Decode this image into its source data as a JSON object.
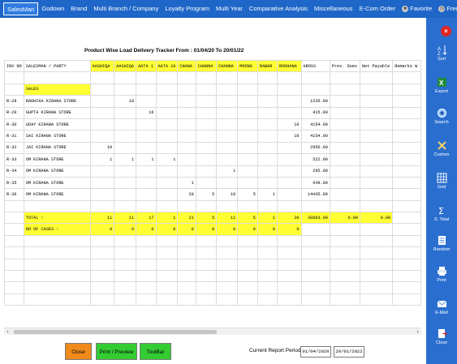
{
  "menu": {
    "items": [
      "SalesMan",
      "Godown",
      "Brand",
      "Multi Branch / Company",
      "Loyalty Program",
      "Multi Year",
      "Comparative Analysis",
      "Miscellaneous",
      "E-Com Order",
      "Favorite",
      "Frequent"
    ]
  },
  "report": {
    "title": "Product Wise Load  Delivery Tracker From : 01/04/20 To 20/01/22"
  },
  "grid": {
    "headers": [
      "INV NO",
      "SALESMAN / PARTY",
      "AASHIQA",
      "AASHIQA",
      "AATA 1",
      "AATA 10",
      "CHANA",
      "CHANNA",
      "CHANNA",
      "MOONG",
      "RABAR",
      "ROOHANA",
      "GROSS",
      "Prev. Dues",
      "Net Payable",
      "Remarks W"
    ],
    "group_label": "SALES",
    "rows": [
      [
        "R-28",
        "RADHIKA KIRANA STORE",
        "",
        "10",
        "",
        "",
        "",
        "",
        "",
        "",
        "",
        "",
        "1235.00",
        "",
        "",
        ""
      ],
      [
        "R-29",
        "GUPTA KIRANA STORE",
        "",
        "",
        "16",
        "",
        "",
        "",
        "",
        "",
        "",
        "",
        "415.00",
        "",
        "",
        ""
      ],
      [
        "R-30",
        "UDAY KIRANA STORE",
        "",
        "",
        "",
        "",
        "",
        "",
        "",
        "",
        "",
        "10",
        "4154.00",
        "",
        "",
        ""
      ],
      [
        "R-31",
        "SAI KIRANA STORE",
        "",
        "",
        "",
        "",
        "",
        "",
        "",
        "",
        "",
        "10",
        "4154.00",
        "",
        "",
        ""
      ],
      [
        "R-32",
        "JAI KIRANA STORE",
        "10",
        "",
        "",
        "",
        "",
        "",
        "",
        "",
        "",
        "",
        "2950.00",
        "",
        "",
        ""
      ],
      [
        "R-33",
        "OM KIRANA STORE",
        "1",
        "1",
        "1",
        "1",
        "",
        "",
        "",
        "",
        "",
        "",
        "522.00",
        "",
        "",
        ""
      ],
      [
        "R-34",
        "OM KIRANA STORE",
        "",
        "",
        "",
        "",
        "",
        "",
        "1",
        "",
        "",
        "",
        "295.00",
        "",
        "",
        ""
      ],
      [
        "R-35",
        "OM KIRANA STORE",
        "",
        "",
        "",
        "",
        "1",
        "",
        "",
        "",
        "",
        "",
        "649.00",
        "",
        "",
        ""
      ],
      [
        "R-36",
        "OM KIRANA STORE",
        "",
        "",
        "",
        "",
        "20",
        "5",
        "10",
        "5",
        "1",
        "",
        "14435.00",
        "",
        "",
        ""
      ]
    ],
    "total": [
      "",
      "TOTAL :",
      "11",
      "11",
      "17",
      "1",
      "21",
      "5",
      "11",
      "5",
      "1",
      "20",
      "30863.00",
      "0.00",
      "0.00",
      ""
    ],
    "cases": [
      "",
      "NO OF CASES :",
      "0",
      "0",
      "0",
      "0",
      "0",
      "0",
      "0",
      "0",
      "0",
      "0",
      "",
      "",
      "",
      ""
    ]
  },
  "buttons": {
    "close": "Close",
    "print": "Print / Preview",
    "toolbar": "ToolBar"
  },
  "period": {
    "label": "Current Report Period",
    "from": "01/04/2020",
    "to": "20/01/2022"
  },
  "sidebar": {
    "items": [
      "Sort",
      "Export",
      "Search",
      "Custom",
      "Grid",
      "S. Total",
      "Random",
      "Print",
      "E-Mail",
      "Close"
    ]
  },
  "colors": {
    "menubar": "#1e66c8",
    "sidebar": "#2a6fd0",
    "highlight": "#ffff33",
    "close_button": "#f08a1a",
    "green_button": "#33cc33"
  },
  "icons": {
    "favorite": "star-icon",
    "frequent": "clock-icon",
    "close": "close-icon"
  }
}
